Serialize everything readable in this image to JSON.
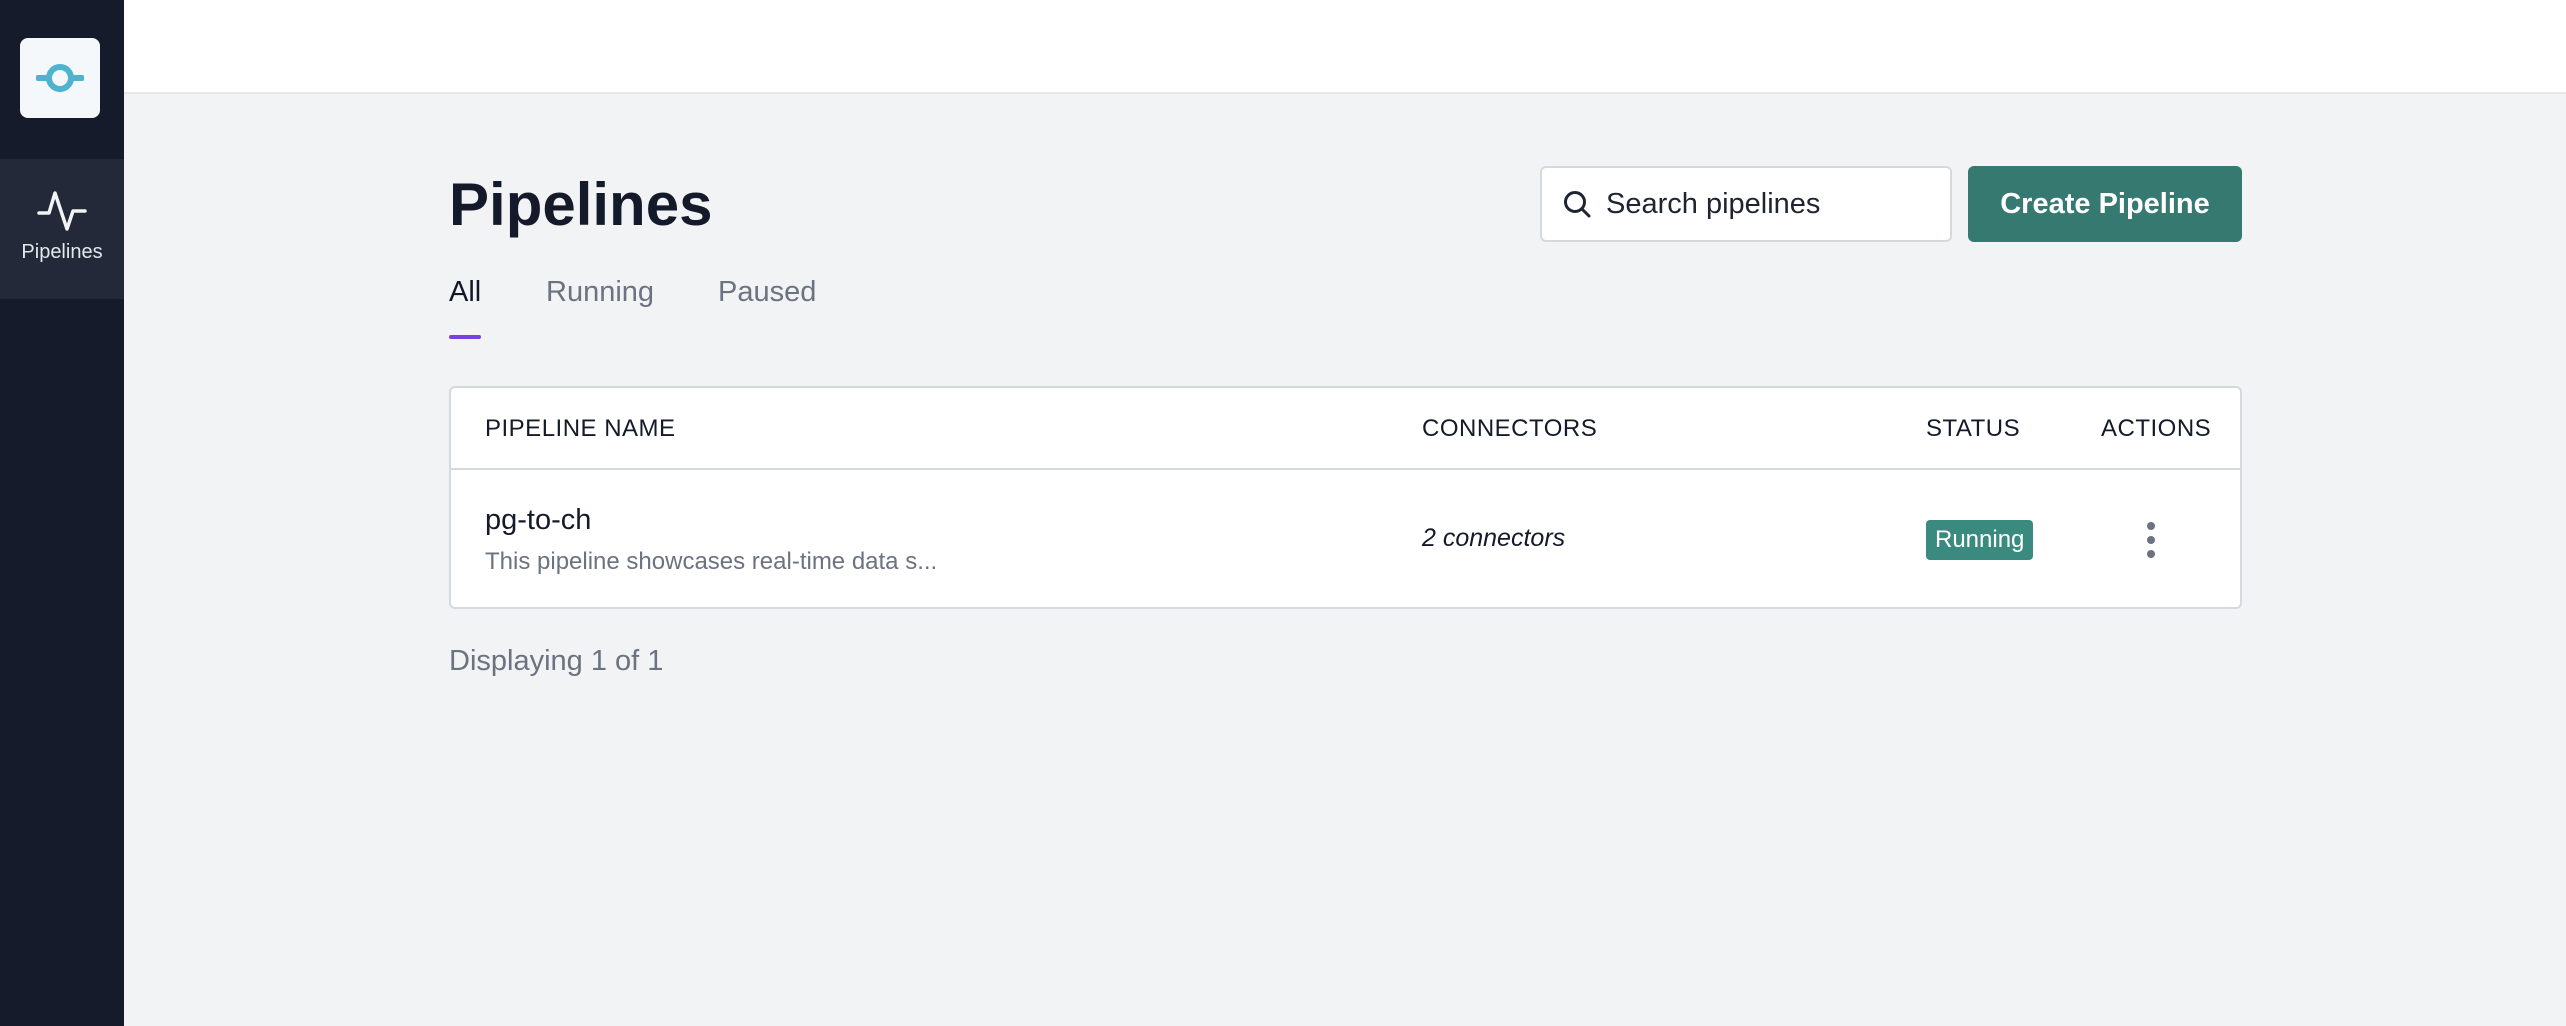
{
  "sidebar": {
    "logo_icon": "pipeline-logo-icon",
    "items": [
      {
        "label": "Pipelines",
        "icon": "activity-pulse-icon"
      }
    ]
  },
  "header": {
    "title": "Pipelines",
    "search": {
      "placeholder": "Search pipelines",
      "value": ""
    },
    "create_button_label": "Create Pipeline"
  },
  "tabs": [
    {
      "label": "All",
      "active": true
    },
    {
      "label": "Running",
      "active": false
    },
    {
      "label": "Paused",
      "active": false
    }
  ],
  "table": {
    "columns": [
      "PIPELINE NAME",
      "CONNECTORS",
      "STATUS",
      "ACTIONS"
    ],
    "rows": [
      {
        "name": "pg-to-ch",
        "description": "This pipeline showcases real-time data s...",
        "connectors": "2 connectors",
        "status": "Running",
        "actions_icon": "more-vertical-icon"
      }
    ]
  },
  "footer": {
    "count_text": "Displaying 1 of 1"
  },
  "colors": {
    "sidebar_bg": "#161b2b",
    "accent": "#367970",
    "status_running": "#3b8a80",
    "tab_indicator": "#7b3fe4",
    "logo": "#4fb3cf"
  }
}
